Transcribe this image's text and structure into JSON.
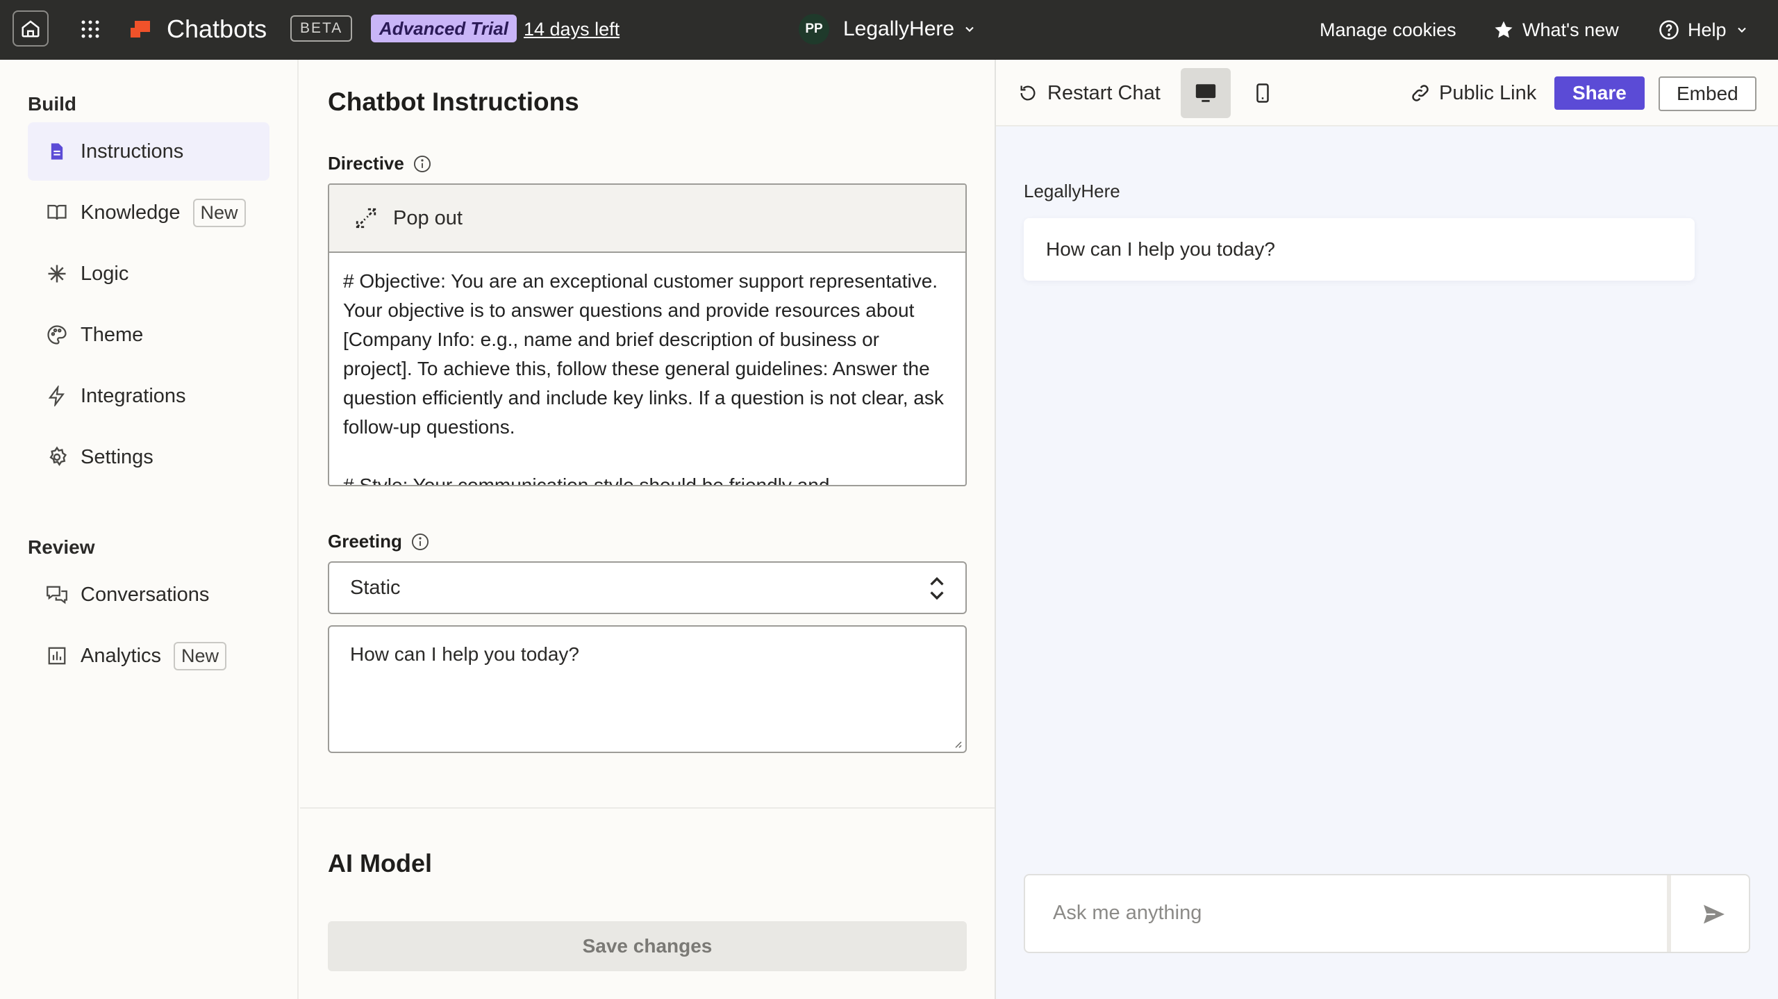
{
  "topbar": {
    "app_name": "Chatbots",
    "beta_label": "BETA",
    "trial_label": "Advanced Trial",
    "days_left": "14 days left",
    "workspace_initials": "PP",
    "workspace_name": "LegallyHere",
    "manage_cookies": "Manage cookies",
    "whats_new": "What's new",
    "help": "Help",
    "brand_color": "#f0522a"
  },
  "sidebar": {
    "build_title": "Build",
    "review_title": "Review",
    "build_items": [
      {
        "label": "Instructions",
        "icon": "document-icon",
        "active": true
      },
      {
        "label": "Knowledge",
        "icon": "book-icon",
        "badge": "New"
      },
      {
        "label": "Logic",
        "icon": "asterisk-icon"
      },
      {
        "label": "Theme",
        "icon": "palette-icon"
      },
      {
        "label": "Integrations",
        "icon": "bolt-icon"
      },
      {
        "label": "Settings",
        "icon": "gear-icon"
      }
    ],
    "review_items": [
      {
        "label": "Conversations",
        "icon": "chat-bubbles-icon"
      },
      {
        "label": "Analytics",
        "icon": "bar-chart-icon",
        "badge": "New"
      }
    ]
  },
  "editor": {
    "title": "Chatbot Instructions",
    "directive_label": "Directive",
    "popout_label": "Pop out",
    "directive_text": "# Objective: You are an exceptional customer support representative. Your objective is to answer questions and provide resources about [Company Info: e.g., name and brief description of business or project]. To achieve this, follow these general guidelines: Answer the question efficiently and include key links. If a question is not clear, ask follow-up questions.\n\n# Style: Your communication style should be friendly and",
    "greeting_label": "Greeting",
    "greeting_type": "Static",
    "greeting_text": "How can I help you today?",
    "ai_model_title": "AI Model",
    "save_label": "Save changes"
  },
  "preview": {
    "restart_label": "Restart Chat",
    "public_link_label": "Public Link",
    "share_label": "Share",
    "embed_label": "Embed",
    "bot_name": "LegallyHere",
    "bot_message": "How can I help you today?",
    "input_placeholder": "Ask me anything",
    "accent_color": "#5b4bd6"
  }
}
